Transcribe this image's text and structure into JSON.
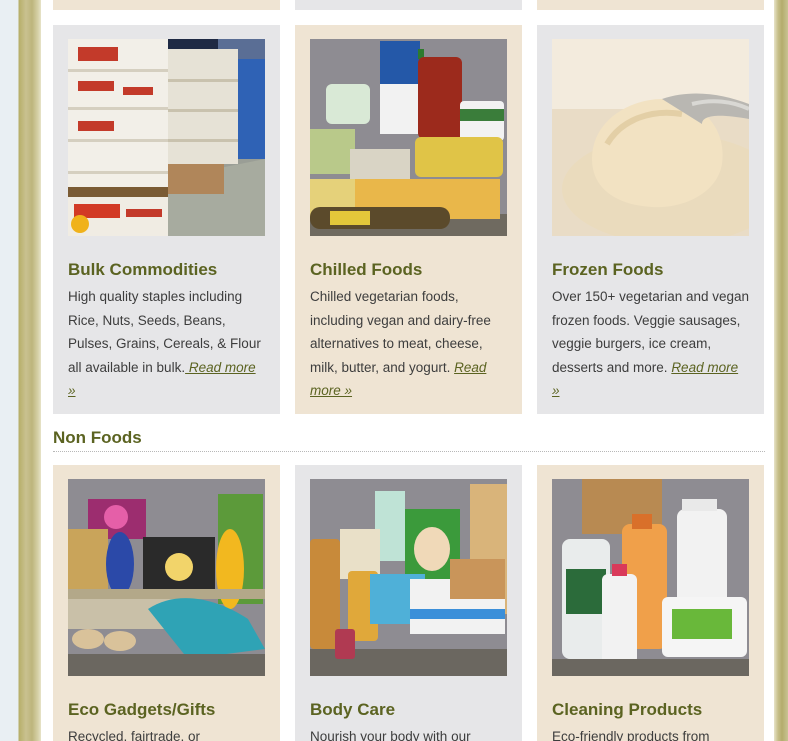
{
  "colors": {
    "heading_olive": "#5b6321",
    "card_grey": "#e6e6e8",
    "card_beige": "#efe4d3",
    "body_text": "#3d3d3d"
  },
  "food_cards": [
    {
      "title": "Bulk Commodities",
      "description": "High quality staples including Rice, Nuts, Seeds, Beans, Pulses, Grains, Cereals, & Flour all available in bulk.",
      "link": " Read more »",
      "image_icon": "warehouse-pallets-image"
    },
    {
      "title": "Chilled Foods",
      "description": "Chilled vegetarian foods, including vegan and dairy-free alternatives to meat, cheese, milk, butter, and yogurt. ",
      "link": "Read more »",
      "image_icon": "chilled-products-image"
    },
    {
      "title": "Frozen Foods",
      "description": "Over 150+ vegetarian and vegan frozen foods. Veggie sausages, veggie burgers, ice cream, desserts and more. ",
      "link": "Read more »",
      "image_icon": "ice-cream-scoop-image"
    }
  ],
  "non_foods": {
    "section_title": "Non Foods",
    "cards": [
      {
        "title": "Eco Gadgets/Gifts",
        "description": "Recycled, fairtrade, or",
        "image_icon": "eco-gadgets-image"
      },
      {
        "title": "Body Care",
        "description": "Nourish your body with our",
        "image_icon": "body-care-products-image"
      },
      {
        "title": "Cleaning Products",
        "description": "Eco-friendly products from",
        "image_icon": "cleaning-products-image"
      }
    ]
  }
}
